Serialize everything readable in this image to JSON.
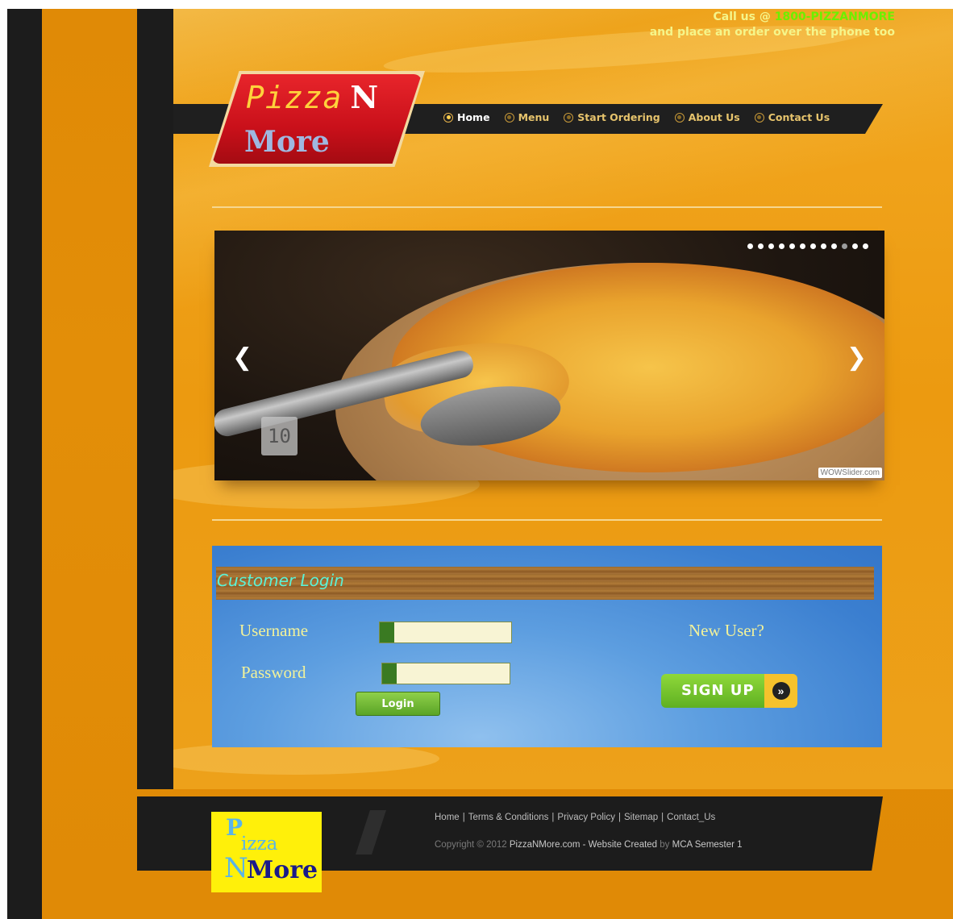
{
  "header": {
    "call_prefix": "Call us @ ",
    "phone": "1800-PIZZANMORE",
    "call_line2": "and place an order over the phone too"
  },
  "logo": {
    "word1": "Pizza",
    "word2": "N",
    "word3": "More"
  },
  "nav": {
    "items": [
      {
        "label": "Home",
        "active": true
      },
      {
        "label": "Menu"
      },
      {
        "label": "Start Ordering"
      },
      {
        "label": "About Us"
      },
      {
        "label": "Contact Us"
      }
    ]
  },
  "slider": {
    "slide_number": "10",
    "total_slides": 12,
    "active_slide": 10,
    "credit": "WOWSlider.com",
    "prev_icon": "chevron-left-icon",
    "next_icon": "chevron-right-icon"
  },
  "login": {
    "title": "Customer Login",
    "username_label": "Username",
    "password_label": "Password",
    "username_value": "",
    "password_value": "",
    "login_button": "Login",
    "new_user_label": "New User?",
    "signup_button": "SIGN UP"
  },
  "footer": {
    "logo": {
      "p": "P",
      "izza": "izza",
      "n": "N",
      "more": "More"
    },
    "links": [
      "Home",
      "Terms & Conditions",
      "Privacy Policy",
      "Sitemap",
      "Contact_Us"
    ],
    "copyright_pre": "Copyright © 2012 ",
    "site_name": "PizzaNMore.com",
    "copyright_mid": " - Website Created ",
    "by": "by",
    "creator": " MCA Semester 1"
  },
  "colors": {
    "page_bg": "#e08a06",
    "dark": "#1c1c1c",
    "content_bg": "#eda11a",
    "call_text": "#f5f58a",
    "phone": "#6cf000",
    "login_blue": "#3b7fd0",
    "login_title": "#5cf1d6",
    "label_yellow": "#f2f29a",
    "green_button": "#5aa426"
  }
}
